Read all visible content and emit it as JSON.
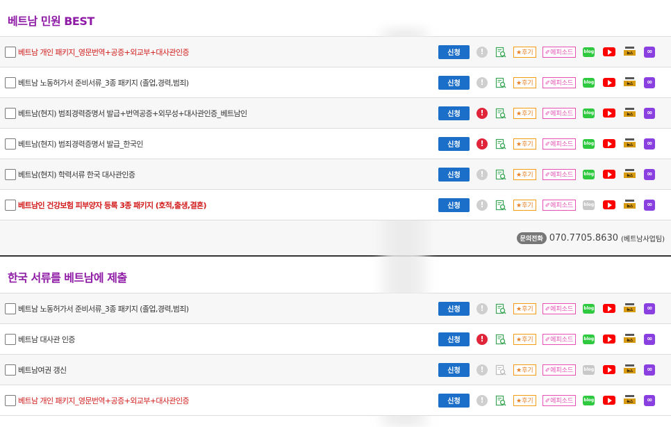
{
  "sections": [
    {
      "title": "베트남 민원 BEST",
      "rows": [
        {
          "label": "베트남 개인 패키지_영문번역+공증+외교부+대사관인증",
          "red": true,
          "bold": false,
          "alert": false,
          "doc_active": true,
          "blog_active": true
        },
        {
          "label": "베트남 노동허가서 준비서류_3종 패키지 (졸업,경력,범죄)",
          "red": false,
          "bold": false,
          "alert": false,
          "doc_active": true,
          "blog_active": true
        },
        {
          "label": "베트남(현지) 범죄경력증명서 발급+번역공증+외무성+대사관인증_베트남인",
          "red": false,
          "bold": false,
          "alert": true,
          "doc_active": true,
          "blog_active": true
        },
        {
          "label": "베트남(현지) 범죄경력증명서 발급_한국인",
          "red": false,
          "bold": false,
          "alert": true,
          "doc_active": true,
          "blog_active": true
        },
        {
          "label": "베트남(현지) 학력서류 한국 대사관인증",
          "red": false,
          "bold": false,
          "alert": false,
          "doc_active": true,
          "blog_active": true
        },
        {
          "label": "베트남인 건강보험 피부양자 등록 3종 패키지 (호적,출생,결혼)",
          "red": true,
          "bold": true,
          "alert": false,
          "doc_active": true,
          "blog_active": false
        }
      ]
    },
    {
      "title": "한국 서류를 베트남에 제출",
      "rows": [
        {
          "label": "베트남 노동허가서 준비서류_3종 패키지 (졸업,경력,범죄)",
          "red": false,
          "bold": false,
          "alert": false,
          "doc_active": true,
          "blog_active": true
        },
        {
          "label": "베트남 대사관 인증",
          "red": false,
          "bold": false,
          "alert": true,
          "doc_active": true,
          "blog_active": true
        },
        {
          "label": "베트남여권 갱신",
          "red": false,
          "bold": false,
          "alert": false,
          "doc_active": false,
          "blog_active": false
        },
        {
          "label": "베트남 개인 패키지_영문번역+공증+외교부+대사관인증",
          "red": true,
          "bold": false,
          "alert": false,
          "doc_active": true,
          "blog_active": true
        }
      ]
    }
  ],
  "actions": {
    "apply_label": "신청",
    "alert_glyph": "!",
    "review_label": "★후기",
    "episode_label": "✐에피소드",
    "blog_label": "blog",
    "news_label": "뉴스",
    "link_glyph": "∞"
  },
  "contact": {
    "badge": "문의전화",
    "phone": "070.7705.8630",
    "team": "(베트남사업팀)"
  },
  "colors": {
    "title": "#8e1aa6",
    "apply_button": "#1b6fc8",
    "alert_active": "#e0243a",
    "alert_inactive": "#cfcfcf",
    "red_text": "#d21c1c",
    "blog": "#2fc940",
    "youtube": "#ff0000",
    "link": "#8a3fe0"
  },
  "icons": [
    "checkbox",
    "alert-icon",
    "document-search-icon",
    "review-badge",
    "episode-badge",
    "blog-icon",
    "youtube-icon",
    "news-icon",
    "link-icon"
  ]
}
